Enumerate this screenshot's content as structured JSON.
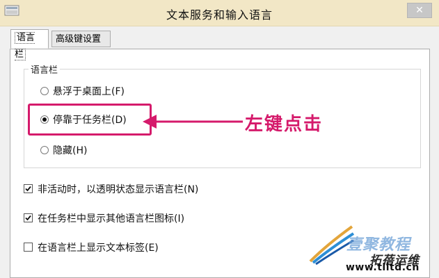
{
  "window": {
    "title": "文本服务和输入语言"
  },
  "tabs": [
    {
      "label": "语言栏"
    },
    {
      "label": "高级键设置"
    }
  ],
  "language_bar_group": {
    "legend": "语言栏",
    "options": [
      {
        "label": "悬浮于桌面上(F)",
        "checked": false
      },
      {
        "label": "停靠于任务栏(D)",
        "checked": true
      },
      {
        "label": "隐藏(H)",
        "checked": false
      }
    ]
  },
  "checkboxes": [
    {
      "label": "非活动时，以透明状态显示语言栏(N)",
      "checked": true
    },
    {
      "label": "在任务栏中显示其他语言栏图标(I)",
      "checked": true
    },
    {
      "label": "在语言栏上显示文本标签(E)",
      "checked": false
    }
  ],
  "annotation": {
    "text": "左键点击",
    "color": "#d51a6b"
  },
  "watermark": {
    "line1": "壹聚教程",
    "line2": "拓蓓运维",
    "line3": "www.tlltd.cn"
  }
}
